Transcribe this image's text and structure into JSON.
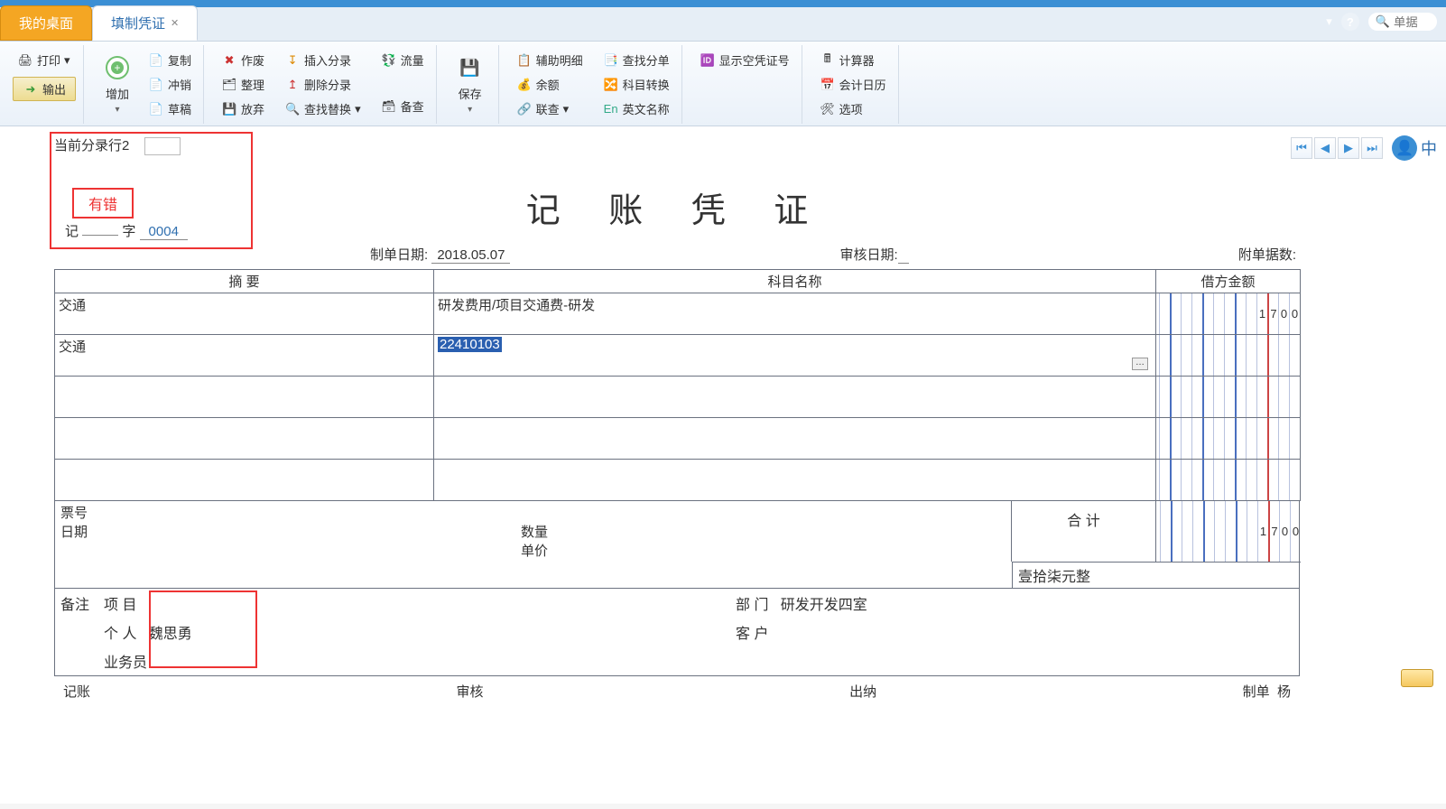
{
  "tabs": {
    "home": "我的桌面",
    "active": "填制凭证"
  },
  "topbar": {
    "search_placeholder": "单据"
  },
  "ribbon": {
    "print": "打印",
    "export": "输出",
    "add": "增加",
    "copy": "复制",
    "reverse": "冲销",
    "draft": "草稿",
    "void": "作废",
    "tidy": "整理",
    "discard": "放弃",
    "insert_entry": "插入分录",
    "delete_entry": "删除分录",
    "findrepl": "查找替换",
    "flow": "流量",
    "backup": "备查",
    "save": "保存",
    "aux_detail": "辅助明细",
    "balance": "余额",
    "related": "联查",
    "find_split": "查找分单",
    "acct_convert": "科目转换",
    "eng_name": "英文名称",
    "show_empty": "显示空凭证号",
    "calculator": "计算器",
    "acct_calendar": "会计日历",
    "options": "选项"
  },
  "nav_tag": "中",
  "voucher": {
    "current_line_label": "当前分录行",
    "current_line_value": "2",
    "error_label": "有错",
    "type": "记",
    "zi": "字",
    "number": "0004",
    "title": "记 账 凭 证",
    "make_date_label": "制单日期:",
    "make_date": "2018.05.07",
    "audit_date_label": "审核日期:",
    "audit_date": "",
    "attach_label": "附单据数:",
    "cols": {
      "summary": "摘 要",
      "account": "科目名称",
      "debit": "借方金额"
    },
    "rows": [
      {
        "summary": "交通",
        "account": "研发费用/项目交通费-研发",
        "debit": "1700",
        "code": ""
      },
      {
        "summary": "交通",
        "account": "",
        "debit": "",
        "code": "22410103"
      },
      {
        "summary": "",
        "account": "",
        "debit": "",
        "code": ""
      },
      {
        "summary": "",
        "account": "",
        "debit": "",
        "code": ""
      },
      {
        "summary": "",
        "account": "",
        "debit": "",
        "code": ""
      }
    ],
    "footer": {
      "ticket": "票号",
      "date": "日期",
      "qty": "数量",
      "price": "单价",
      "total_label": "合 计",
      "total_debit": "1700",
      "cn_amount": "壹拾柒元整"
    },
    "remarks": {
      "label": "备注",
      "project": "项 目",
      "person": "个 人",
      "clerk": "业务员",
      "dept": "部 门",
      "dept_val": "研发开发四室",
      "customer": "客 户",
      "person_val": "魏思勇"
    },
    "sign": {
      "book": "记账",
      "audit": "审核",
      "cashier": "出纳",
      "maker": "制单",
      "maker_val": "杨"
    }
  }
}
